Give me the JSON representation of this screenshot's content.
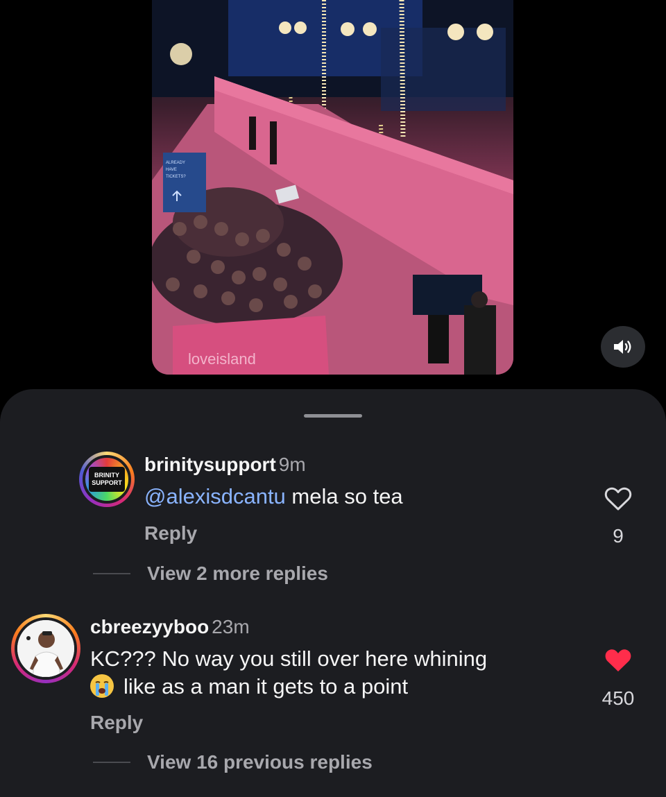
{
  "video": {
    "sign_text": [
      "ALREADY",
      "HAVE",
      "TICKETS?"
    ],
    "banner_text": "loveisland"
  },
  "mute_button": {
    "icon": "speaker-icon"
  },
  "comments": [
    {
      "username": "brinitysupport",
      "time": "9m",
      "avatar_text": [
        "BRINITY",
        "SUPPORT"
      ],
      "mention": "@alexisdcantu",
      "text": " mela so tea",
      "reply_label": "Reply",
      "likes": "9",
      "liked": false,
      "view_replies": "View 2 more replies"
    },
    {
      "username": "cbreezyyboo",
      "time": "23m",
      "line1": "KC??? No way you still over here whining",
      "emoji": "😭",
      "line2": "like as a man it gets to a point",
      "reply_label": "Reply",
      "likes": "450",
      "liked": true,
      "view_replies": "View 16 previous replies"
    }
  ],
  "colors": {
    "sheet_bg": "#1c1d21",
    "mention": "#8ab4ff",
    "liked_heart": "#ff2d4b",
    "story_ring_start": "#feda75",
    "story_ring_end": "#d62976"
  }
}
